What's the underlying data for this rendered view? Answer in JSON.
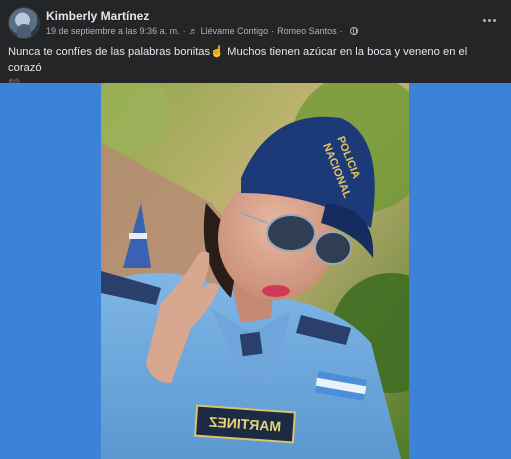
{
  "post": {
    "author": "Kimberly Martínez",
    "date": "19 de septiembre a las 9:36 a. m.",
    "music_separator": "·",
    "song": "Llévame Contigo",
    "artist_separator": "·",
    "artist": "Romeo Santos",
    "audience_separator": "·",
    "caption_text": "Nunca te confíes de las palabras bonitas",
    "caption_emoji": "☝",
    "caption_rest": " Muchos tienen azúcar en la boca y veneno en el corazó",
    "caption_end": "🖤"
  },
  "photo": {
    "cap_text_line1": "POLICIA",
    "cap_text_line2": "NACIONAL",
    "name_tape": "MARTINEZ"
  },
  "icons": {
    "avatar": "profile-photo",
    "music": "music-note-icon",
    "audience": "globe-icon",
    "more": "more-options-icon"
  },
  "colors": {
    "background": "#242526",
    "media_background": "#3d82d9",
    "text_primary": "#e4e6eb",
    "text_secondary": "#b0b3b8"
  }
}
